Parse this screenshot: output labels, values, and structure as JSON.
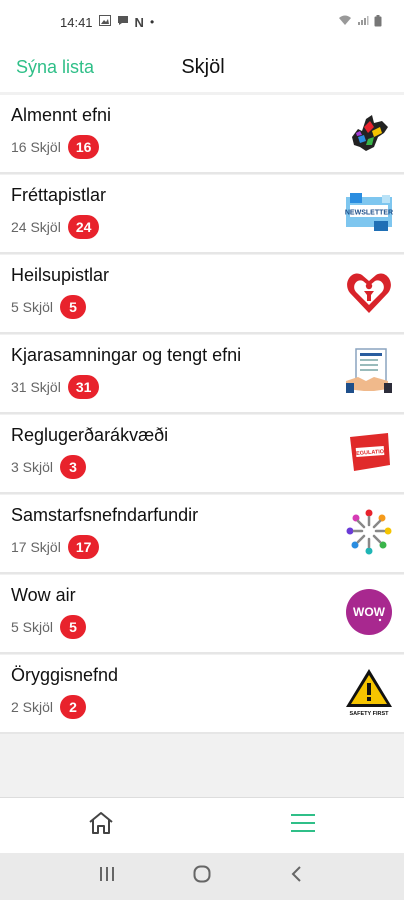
{
  "status_bar": {
    "time": "14:41",
    "n_icon": "N",
    "dot": "•"
  },
  "header": {
    "back_label": "Sýna lista",
    "title": "Skjöl"
  },
  "items": [
    {
      "name": "Almennt efni",
      "count_text": "16 Skjöl",
      "badge": "16",
      "icon": "west-virginia-map-icon"
    },
    {
      "name": "Fréttapistlar",
      "count_text": "24 Skjöl",
      "badge": "24",
      "icon": "newsletter-icon"
    },
    {
      "name": "Heilsupistlar",
      "count_text": "5 Skjöl",
      "badge": "5",
      "icon": "heart-health-icon"
    },
    {
      "name": "Kjarasamningar og tengt efni",
      "count_text": "31 Skjöl",
      "badge": "31",
      "icon": "handshake-document-icon"
    },
    {
      "name": "Reglugerðarákvæði",
      "count_text": "3 Skjöl",
      "badge": "3",
      "icon": "regulation-sign-icon"
    },
    {
      "name": "Samstarfsnefndarfundir",
      "count_text": "17 Skjöl",
      "badge": "17",
      "icon": "people-circle-icon"
    },
    {
      "name": "Wow air",
      "count_text": "5 Skjöl",
      "badge": "5",
      "icon": "wow-air-logo-icon"
    },
    {
      "name": "Öryggisnefnd",
      "count_text": "2 Skjöl",
      "badge": "2",
      "icon": "safety-first-warning-icon"
    }
  ],
  "wow_logo_text": "WOW",
  "safety_text": "SAFETY FIRST",
  "newsletter_text": "NEWSLETTER",
  "regulation_text": "REGULATION",
  "colors": {
    "accent": "#2fbf88",
    "badge": "#e8222c"
  },
  "bottom_nav": {
    "home_icon": "home-icon",
    "menu_icon": "menu-icon"
  }
}
